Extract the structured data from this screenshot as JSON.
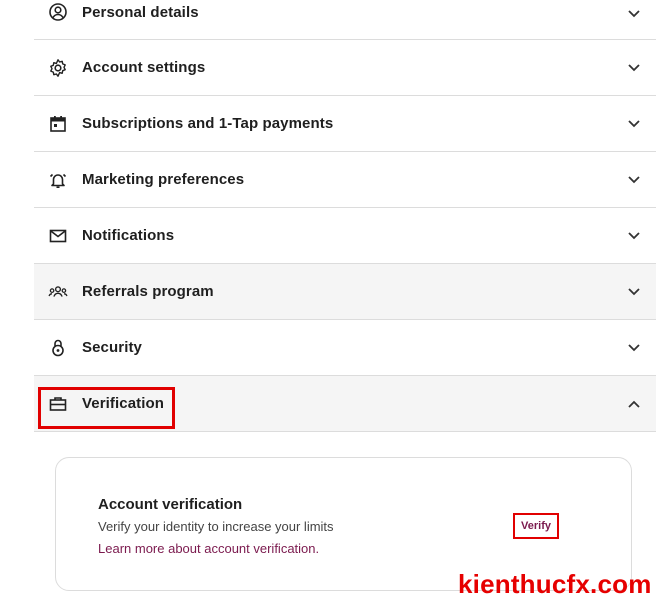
{
  "menu": {
    "items": [
      {
        "label": "Personal details",
        "icon": "user-circle-icon",
        "expanded": false
      },
      {
        "label": "Account settings",
        "icon": "gear-icon",
        "expanded": false
      },
      {
        "label": "Subscriptions and 1-Tap payments",
        "icon": "calendar-icon",
        "expanded": false
      },
      {
        "label": "Marketing preferences",
        "icon": "bell-icon",
        "expanded": false
      },
      {
        "label": "Notifications",
        "icon": "mail-icon",
        "expanded": false
      },
      {
        "label": "Referrals program",
        "icon": "people-icon",
        "expanded": false
      },
      {
        "label": "Security",
        "icon": "lock-icon",
        "expanded": false
      },
      {
        "label": "Verification",
        "icon": "briefcase-icon",
        "expanded": true
      }
    ]
  },
  "verification_card": {
    "title": "Account verification",
    "description": "Verify your identity to increase your limits",
    "link": "Learn more about account verification.",
    "button": "Verify"
  },
  "watermark": "kienthucfx.com",
  "colors": {
    "highlight": "#e10000",
    "link": "#7b1a4e",
    "watermark": "#e60000"
  }
}
